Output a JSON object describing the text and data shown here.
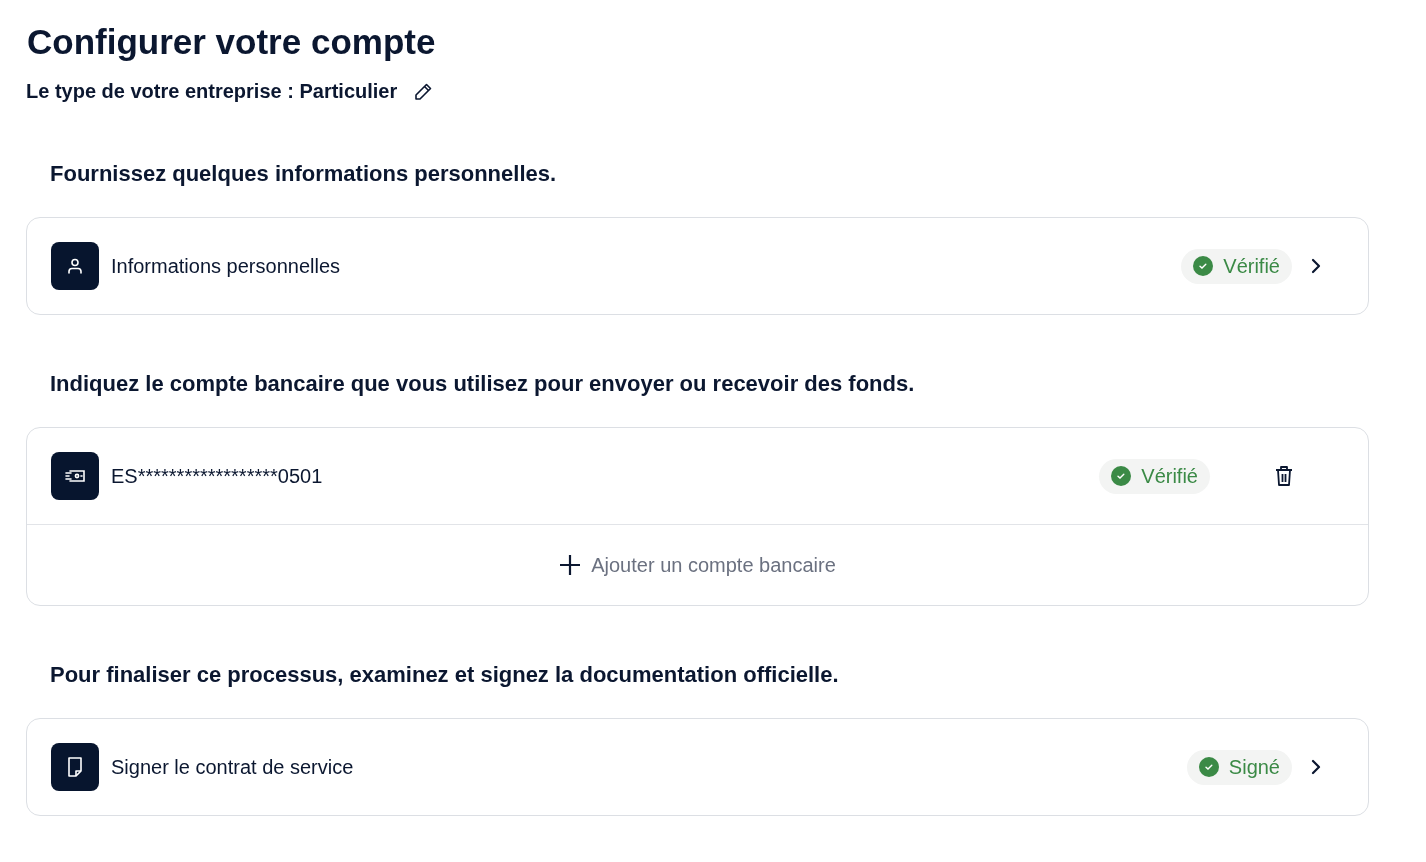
{
  "title": "Configurer votre compte",
  "business_type": {
    "label": "Le type de votre entreprise : Particulier"
  },
  "sections": [
    {
      "heading": "Fournissez quelques informations personnelles.",
      "rows": [
        {
          "kind": "link",
          "label": "Informations personnelles",
          "status": "Vérifié"
        }
      ]
    },
    {
      "heading": "Indiquez le compte bancaire que vous utilisez pour envoyer ou recevoir des fonds.",
      "rows": [
        {
          "kind": "account",
          "label": "ES******************0501",
          "status": "Vérifié"
        },
        {
          "kind": "add",
          "label": "Ajouter un compte bancaire"
        }
      ]
    },
    {
      "heading": "Pour finaliser ce processus, examinez et signez la documentation officielle.",
      "rows": [
        {
          "kind": "link",
          "label": "Signer le contrat de service",
          "status": "Signé"
        }
      ]
    }
  ]
}
